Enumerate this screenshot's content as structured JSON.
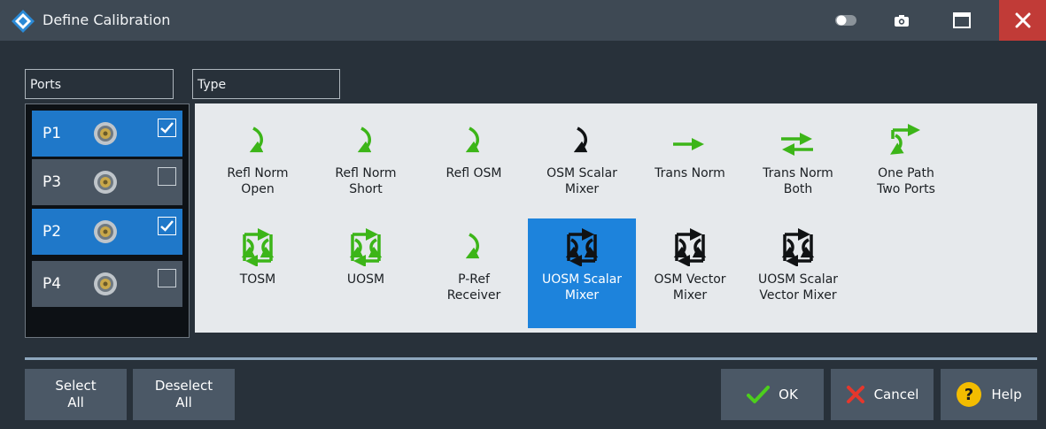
{
  "window": {
    "title": "Define Calibration"
  },
  "titlebar_icons": [
    "toggle-icon",
    "camera-icon",
    "maximize-icon",
    "close-icon"
  ],
  "groups": {
    "ports_label": "Ports",
    "type_label": "Type"
  },
  "ports": [
    {
      "label": "P1",
      "checked": true
    },
    {
      "label": "P3",
      "checked": false
    },
    {
      "label": "P2",
      "checked": true
    },
    {
      "label": "P4",
      "checked": false
    }
  ],
  "types": {
    "selected": "UOSM Scalar Mixer",
    "row1": [
      {
        "l1": "Refl Norm",
        "l2": "Open",
        "icon": "refl-arrow-icon",
        "color": "green"
      },
      {
        "l1": "Refl Norm",
        "l2": "Short",
        "icon": "refl-arrow-icon",
        "color": "green"
      },
      {
        "l1": "Refl OSM",
        "l2": "",
        "icon": "refl-arrow-icon",
        "color": "green"
      },
      {
        "l1": "OSM Scalar",
        "l2": "Mixer",
        "icon": "refl-arrow-icon",
        "color": "black"
      },
      {
        "l1": "Trans Norm",
        "l2": "",
        "icon": "trans-arrow-icon",
        "color": "green"
      },
      {
        "l1": "Trans Norm",
        "l2": "Both",
        "icon": "trans-both-icon",
        "color": "green"
      },
      {
        "l1": "One Path",
        "l2": "Two Ports",
        "icon": "one-path-icon",
        "color": "green"
      }
    ],
    "row2": [
      {
        "l1": "TOSM",
        "l2": "",
        "icon": "two-port-icon",
        "color": "green"
      },
      {
        "l1": "UOSM",
        "l2": "",
        "icon": "two-port-icon",
        "color": "green"
      },
      {
        "l1": "P-Ref",
        "l2": "Receiver",
        "icon": "refl-arrow-icon",
        "color": "green"
      },
      {
        "l1": "UOSM Scalar",
        "l2": "Mixer",
        "icon": "two-port-icon",
        "color": "black"
      },
      {
        "l1": "OSM Vector",
        "l2": "Mixer",
        "icon": "two-port-icon",
        "color": "black"
      },
      {
        "l1": "UOSM Scalar",
        "l2": "Vector Mixer",
        "icon": "two-port-icon",
        "color": "black"
      }
    ]
  },
  "buttons": {
    "select_all_l1": "Select",
    "select_all_l2": "All",
    "deselect_all_l1": "Deselect",
    "deselect_all_l2": "All",
    "ok": "OK",
    "cancel": "Cancel",
    "help": "Help",
    "help_glyph": "?"
  },
  "colors": {
    "accent_blue": "#1f78c9",
    "selected_tile": "#1d83dc",
    "icon_green": "#3cb518",
    "close_red": "#c13b37",
    "help_yellow": "#f3bc00"
  }
}
